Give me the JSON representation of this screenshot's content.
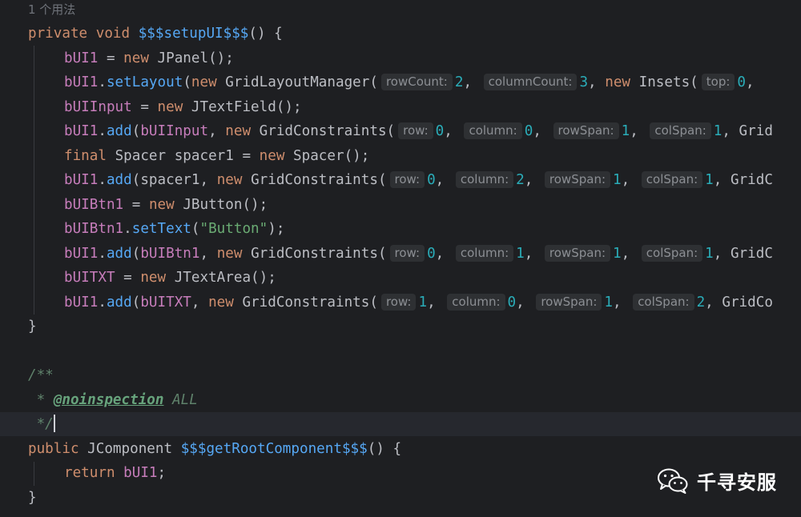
{
  "usage_hint": "1 个用法",
  "lines": [
    [
      [
        "kw",
        "private void "
      ],
      [
        "mth",
        "$$$setupUI$$$"
      ],
      [
        "plain",
        "() {"
      ]
    ],
    [
      [
        "fld",
        "bUI1"
      ],
      [
        "plain",
        " = "
      ],
      [
        "kw",
        "new "
      ],
      [
        "plain",
        "JPanel();"
      ]
    ],
    [
      [
        "fld",
        "bUI1"
      ],
      [
        "plain",
        "."
      ],
      [
        "call",
        "setLayout"
      ],
      [
        "plain",
        "("
      ],
      [
        "kw",
        "new "
      ],
      [
        "plain",
        "GridLayoutManager("
      ],
      [
        "hint",
        "rowCount:"
      ],
      [
        "num",
        "2"
      ],
      [
        "plain",
        ", "
      ],
      [
        "hint",
        "columnCount:"
      ],
      [
        "num",
        "3"
      ],
      [
        "plain",
        ", "
      ],
      [
        "kw",
        "new "
      ],
      [
        "plain",
        "Insets("
      ],
      [
        "hint",
        "top:"
      ],
      [
        "num",
        "0"
      ],
      [
        "plain",
        ", "
      ]
    ],
    [
      [
        "fld",
        "bUIInput"
      ],
      [
        "plain",
        " = "
      ],
      [
        "kw",
        "new "
      ],
      [
        "plain",
        "JTextField();"
      ]
    ],
    [
      [
        "fld",
        "bUI1"
      ],
      [
        "plain",
        "."
      ],
      [
        "call",
        "add"
      ],
      [
        "plain",
        "("
      ],
      [
        "fld",
        "bUIInput"
      ],
      [
        "plain",
        ", "
      ],
      [
        "kw",
        "new "
      ],
      [
        "plain",
        "GridConstraints("
      ],
      [
        "hint",
        "row:"
      ],
      [
        "num",
        "0"
      ],
      [
        "plain",
        ", "
      ],
      [
        "hint",
        "column:"
      ],
      [
        "num",
        "0"
      ],
      [
        "plain",
        ", "
      ],
      [
        "hint",
        "rowSpan:"
      ],
      [
        "num",
        "1"
      ],
      [
        "plain",
        ", "
      ],
      [
        "hint",
        "colSpan:"
      ],
      [
        "num",
        "1"
      ],
      [
        "plain",
        ", Grid"
      ]
    ],
    [
      [
        "kw",
        "final "
      ],
      [
        "plain",
        "Spacer spacer1 = "
      ],
      [
        "kw",
        "new "
      ],
      [
        "plain",
        "Spacer();"
      ]
    ],
    [
      [
        "fld",
        "bUI1"
      ],
      [
        "plain",
        "."
      ],
      [
        "call",
        "add"
      ],
      [
        "plain",
        "(spacer1, "
      ],
      [
        "kw",
        "new "
      ],
      [
        "plain",
        "GridConstraints("
      ],
      [
        "hint",
        "row:"
      ],
      [
        "num",
        "0"
      ],
      [
        "plain",
        ", "
      ],
      [
        "hint",
        "column:"
      ],
      [
        "num",
        "2"
      ],
      [
        "plain",
        ", "
      ],
      [
        "hint",
        "rowSpan:"
      ],
      [
        "num",
        "1"
      ],
      [
        "plain",
        ", "
      ],
      [
        "hint",
        "colSpan:"
      ],
      [
        "num",
        "1"
      ],
      [
        "plain",
        ", GridC"
      ]
    ],
    [
      [
        "fld",
        "bUIBtn1"
      ],
      [
        "plain",
        " = "
      ],
      [
        "kw",
        "new "
      ],
      [
        "plain",
        "JButton();"
      ]
    ],
    [
      [
        "fld",
        "bUIBtn1"
      ],
      [
        "plain",
        "."
      ],
      [
        "call",
        "setText"
      ],
      [
        "plain",
        "("
      ],
      [
        "str",
        "\"Button\""
      ],
      [
        "plain",
        ");"
      ]
    ],
    [
      [
        "fld",
        "bUI1"
      ],
      [
        "plain",
        "."
      ],
      [
        "call",
        "add"
      ],
      [
        "plain",
        "("
      ],
      [
        "fld",
        "bUIBtn1"
      ],
      [
        "plain",
        ", "
      ],
      [
        "kw",
        "new "
      ],
      [
        "plain",
        "GridConstraints("
      ],
      [
        "hint",
        "row:"
      ],
      [
        "num",
        "0"
      ],
      [
        "plain",
        ", "
      ],
      [
        "hint",
        "column:"
      ],
      [
        "num",
        "1"
      ],
      [
        "plain",
        ", "
      ],
      [
        "hint",
        "rowSpan:"
      ],
      [
        "num",
        "1"
      ],
      [
        "plain",
        ", "
      ],
      [
        "hint",
        "colSpan:"
      ],
      [
        "num",
        "1"
      ],
      [
        "plain",
        ", GridC"
      ]
    ],
    [
      [
        "fld",
        "bUITXT"
      ],
      [
        "plain",
        " = "
      ],
      [
        "kw",
        "new "
      ],
      [
        "plain",
        "JTextArea();"
      ]
    ],
    [
      [
        "fld",
        "bUI1"
      ],
      [
        "plain",
        "."
      ],
      [
        "call",
        "add"
      ],
      [
        "plain",
        "("
      ],
      [
        "fld",
        "bUITXT"
      ],
      [
        "plain",
        ", "
      ],
      [
        "kw",
        "new "
      ],
      [
        "plain",
        "GridConstraints("
      ],
      [
        "hint",
        "row:"
      ],
      [
        "num",
        "1"
      ],
      [
        "plain",
        ", "
      ],
      [
        "hint",
        "column:"
      ],
      [
        "num",
        "0"
      ],
      [
        "plain",
        ", "
      ],
      [
        "hint",
        "rowSpan:"
      ],
      [
        "num",
        "1"
      ],
      [
        "plain",
        ", "
      ],
      [
        "hint",
        "colSpan:"
      ],
      [
        "num",
        "2"
      ],
      [
        "plain",
        ", GridCo"
      ]
    ],
    [
      [
        "plain",
        "}"
      ]
    ],
    [],
    [
      [
        "cmt",
        "/**"
      ]
    ],
    [
      [
        "cmt",
        " * "
      ],
      [
        "tag",
        "@noinspection"
      ],
      [
        "cmt",
        " ALL"
      ]
    ],
    [
      [
        "cmt",
        " */"
      ],
      [
        "caret",
        ""
      ]
    ],
    [
      [
        "kw",
        "public "
      ],
      [
        "plain",
        "JComponent "
      ],
      [
        "mth",
        "$$$getRootComponent$$$"
      ],
      [
        "plain",
        "() {"
      ]
    ],
    [
      [
        "kw",
        "return "
      ],
      [
        "fld",
        "bUI1"
      ],
      [
        "plain",
        ";"
      ]
    ],
    [
      [
        "plain",
        "}"
      ]
    ]
  ],
  "watermark": {
    "text": "千寻安服",
    "icon": "wechat-icon"
  },
  "colors": {
    "background": "#1e1f22",
    "keyword": "#cf8e6d",
    "method": "#56a8f5",
    "field": "#c77dbb",
    "number": "#2aacb8",
    "string": "#6aab73",
    "comment": "#5f826b"
  }
}
